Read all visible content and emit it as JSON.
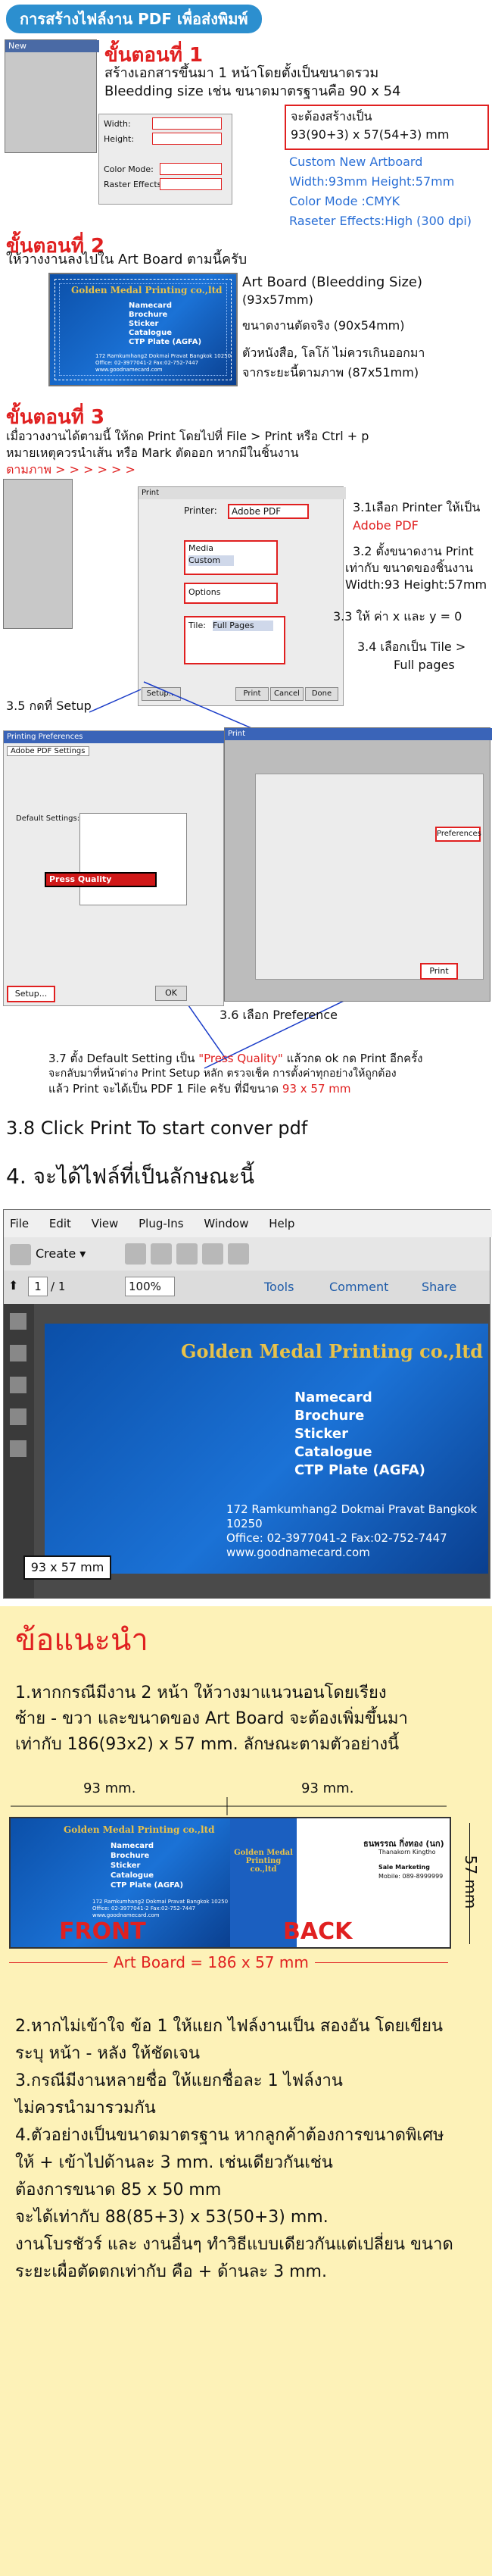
{
  "header": {
    "title": "การสร้างไฟล์งาน PDF เพื่อส่งพิมพ์"
  },
  "step1": {
    "title": "ขั้นตอนที่ 1",
    "desc_line1": "สร้างเอกสารขึ้นมา 1 หน้าโดยตั้งเป็นขนาดรวม",
    "desc_line2": "Bleedding size เช่น ขนาดมาตรฐานคือ 90 x 54",
    "box_line1": "จะต้องสร้างเป็น",
    "box_line2": "93(90+3) x 57(54+3) mm",
    "info": [
      "Custom New Artboard",
      "Width:93mm Height:57mm",
      "Color Mode :CMYK",
      "Raseter Effects:High (300 dpi)"
    ],
    "dialog_title": "New",
    "dialog_fields": [
      "Width:",
      "Height:",
      "Color Mode:",
      "Raster Effects:"
    ]
  },
  "step2": {
    "title": "ขั้นตอนที่ 2",
    "desc": "ให้วางงานลงไปใน Art Board ตามนี้ครับ",
    "label1_line1": "Art Board (Bleedding Size)",
    "label1_line2": "(93x57mm)",
    "label2": "ขนาดงานตัดจริง (90x54mm)",
    "label3_line1": "ตัวหนังสือ, โลโก้ ไม่ควรเกินออกมา",
    "label3_line2": "จากระยะนี้ตามภาพ (87x51mm)"
  },
  "card": {
    "company": "Golden Medal Printing co.,ltd",
    "services": [
      "Namecard",
      "Brochure",
      "Sticker",
      "Catalogue",
      "CTP Plate (AGFA)"
    ],
    "address": "172 Ramkumhang2 Dokmai Pravat Bangkok 10250",
    "phone": "Office: 02-3977041-2  Fax:02-752-7447",
    "web": "www.goodnamecard.com"
  },
  "step3": {
    "title": "ขั้นตอนที่ 3",
    "desc_line1": "เมื่อวางงานได้ตามนี้ ให้กด Print โดยไปที่ File > Print หรือ Ctrl + p",
    "desc_line2": "หมายเหตุควรนำเส้น หรือ Mark ตัดออก หากมีในชิ้นงาน",
    "desc_line3": "ตามภาพ > > > > > >",
    "print_dialog_title": "Print",
    "printer_label": "Printer:",
    "printer_value": "Adobe PDF",
    "media_label": "Media",
    "media_value": "Custom",
    "options_label": "Options",
    "tile_label": "Tile:",
    "tile_value": "Full Pages",
    "setup_button": "Setup...",
    "print_button": "Print",
    "done_button": "Done",
    "cancel_button": "Cancel",
    "note31_line1": "3.1เลือก Printer ให้เป็น",
    "note31_line2": "Adobe PDF",
    "note32_line1": "3.2 ตั้งขนาดงาน Print",
    "note32_line2": "เท่ากับ ขนาดของชิ้นงาน",
    "note32_line3": "Width:93  Height:57mm",
    "note33": "3.3 ให้ ค่า x และ y = 0",
    "note34_line1": "3.4 เลือกเป็น Tile >",
    "note34_line2": "Full pages",
    "note35": "3.5 กดที่ Setup",
    "note36": "3.6 เลือก Preference",
    "pref_dialog_title": "Printing Preferences",
    "pref_tab": "Adobe PDF Settings",
    "default_settings_label": "Default Settings:",
    "press_quality": "Press Quality",
    "preferences_button": "Preferences",
    "setup_dialog_title": "Print",
    "ok_button": "OK",
    "note37_line1_a": "3.7 ตั้ง Default  Setting เป็น ",
    "note37_press": "\"Press Quality\"",
    "note37_line1_b": " แล้วกด ok กด Print อีกครั้ง",
    "note37_line2": "จะกลับมาที่หน้าต่าง Print Setup หลัก ตรวจเช็ค การตั้งค่าทุกอย่างให้ถูกต้อง",
    "note37_line3_a": "แล้ว Print จะได้เป็น PDF 1 File ครับ ที่มีขนาด ",
    "note37_size": "93 x 57 mm",
    "step38": "3.8 Click Print To start conver pdf"
  },
  "step4": {
    "title": "4. จะได้ไฟล์ที่เป็นลักษณะนี้",
    "menu": [
      "File",
      "Edit",
      "View",
      "Plug-Ins",
      "Window",
      "Help"
    ],
    "create_label": "Create",
    "page_current": "1",
    "page_total": "/ 1",
    "zoom": "100%",
    "tools": "Tools",
    "comment": "Comment",
    "share": "Share",
    "size_badge": "93 x 57 mm"
  },
  "advice": {
    "title": "ข้อแนะนำ",
    "p1_line1": "1.หากกรณีมีงาน 2 หน้า ให้วางมาแนวนอนโดยเรียง",
    "p1_line2": "ซ้าย - ขวา และขนาดของ Art Board จะต้องเพิ่มขึ้นมา",
    "p1_line3": "เท่ากับ 186(93x2) x 57 mm. ลักษณะตามตัวอย่างนี้",
    "dim_left": "93 mm.",
    "dim_right": "93 mm.",
    "dim_height": "57 mm",
    "front_label": "FRONT",
    "back_label": "BACK",
    "artboard_label": "Art Board = 186 x 57 mm",
    "back_name": "ธนพรรณ กิ่งทอง (นก)",
    "back_name_en": "Thanakorn Kingtho",
    "back_role": "Sale Marketing",
    "back_mobile": "Mobile: 089-8999999",
    "p2_line1": "2.หากไม่เข้าใจ ข้อ 1 ให้แยก ไฟล์งานเป็น สองอัน โดยเขียน",
    "p2_line2": "ระบุ หน้า - หลัง ให้ชัดเจน",
    "p3_line1": "3.กรณีมีงานหลายชื่อ ให้แยกชื่อละ 1 ไฟล์งาน",
    "p3_line2": "ไม่ควรนำมารวมกัน",
    "p4_line1": "4.ตัวอย่างเป็นขนาดมาตรฐาน หากลูกค้าต้องการขนาดพิเศษ",
    "p4_line2": "ให้ + เข้าไปด้านละ 3 mm. เช่นเดียวกันเช่น",
    "p4_line3": "ต้องการขนาด 85 x 50 mm",
    "p4_line4": "จะได้เท่ากับ 88(85+3) x 53(50+3) mm.",
    "p4_line5": "งานโบรชัวร์ และ งานอื่นๆ ทำวิธีแบบเดียวกันแต่เปลี่ยน ขนาด",
    "p4_line6": "ระยะเผื่อตัดตกเท่ากับ คือ + ด้านละ 3 mm."
  },
  "colors": {
    "accent_blue": "#2c8fcf",
    "red": "#e02020",
    "card_blue": "#0b4fa8",
    "gold": "#e8c24a",
    "advice_bg": "#fdf2b8"
  }
}
